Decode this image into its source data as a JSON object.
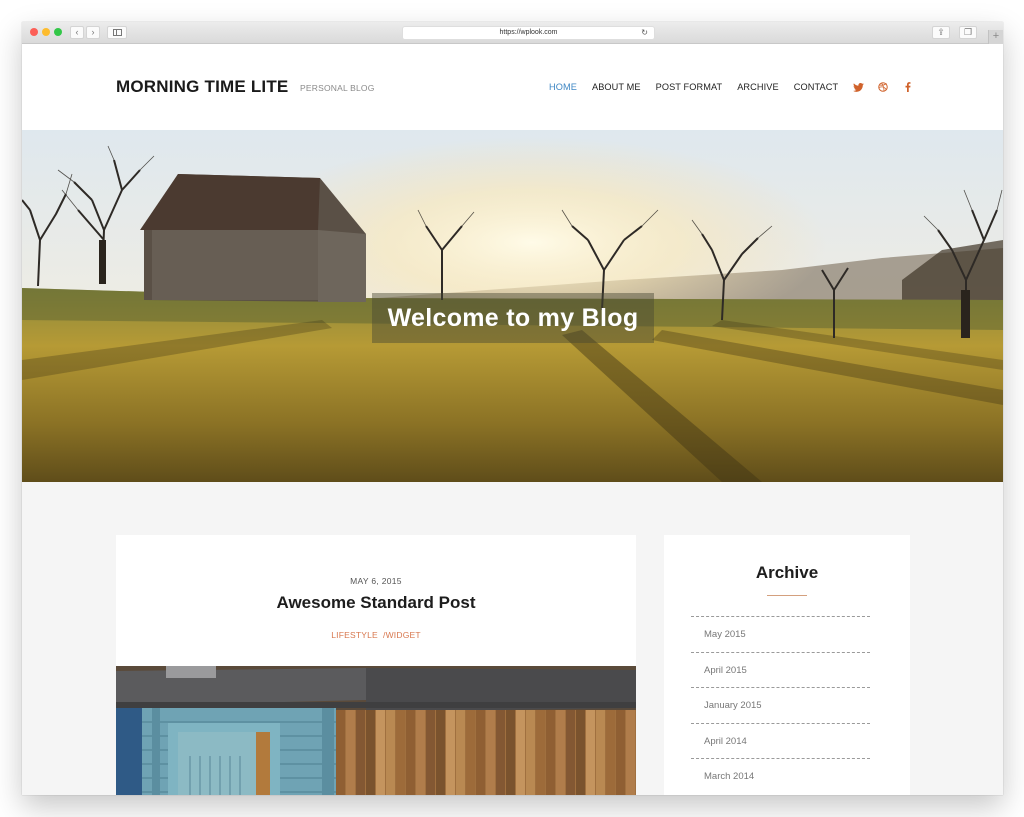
{
  "browser": {
    "url": "https://wplook.com",
    "back_label": "‹",
    "forward_label": "›",
    "reload_glyph": "↻",
    "share_glyph": "⇪",
    "tabs_glyph": "❐",
    "newtab_glyph": "+"
  },
  "header": {
    "site_title": "MORNING TIME LITE",
    "tagline": "PERSONAL BLOG",
    "nav": [
      {
        "label": "HOME",
        "active": true
      },
      {
        "label": "ABOUT ME",
        "active": false
      },
      {
        "label": "POST FORMAT",
        "active": false
      },
      {
        "label": "ARCHIVE",
        "active": false
      },
      {
        "label": "CONTACT",
        "active": false
      }
    ],
    "social": [
      "twitter-icon",
      "dribbble-icon",
      "facebook-icon"
    ],
    "accent_color": "#d0622b",
    "active_nav_color": "#3f87c4"
  },
  "hero": {
    "title": "Welcome to my Blog"
  },
  "post": {
    "date": "MAY 6, 2015",
    "title": "Awesome Standard Post",
    "categories": [
      "LIFESTYLE",
      "/WIDGET"
    ]
  },
  "sidebar": {
    "widget_title": "Archive",
    "archive": [
      "May 2015",
      "April 2015",
      "January 2015",
      "April 2014",
      "March 2014"
    ]
  }
}
